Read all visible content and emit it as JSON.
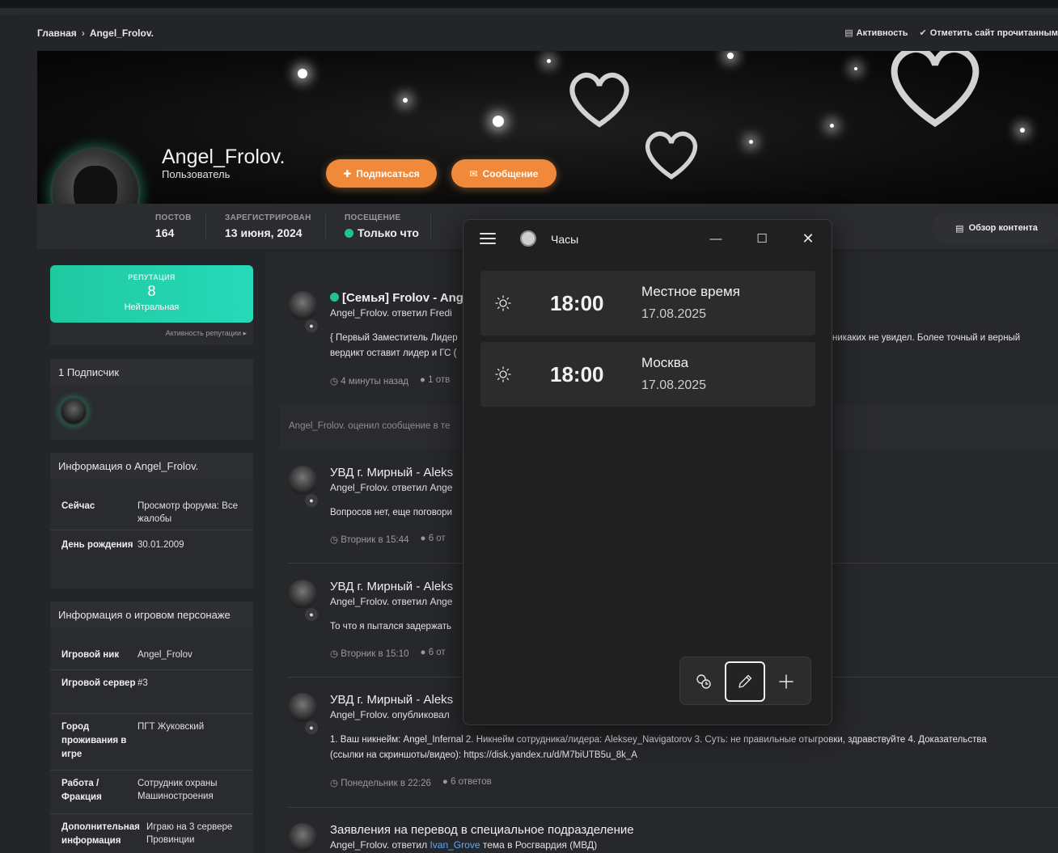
{
  "breadcrumb": {
    "home": "Главная",
    "sep": "›",
    "current": "Angel_Frolov."
  },
  "toplinks": {
    "activity": "Активность",
    "mark_read": "Отметить сайт прочитанным"
  },
  "profile": {
    "name": "Angel_Frolov.",
    "title": "Пользователь",
    "subscribe_label": "Подписаться",
    "message_label": "Сообщение"
  },
  "stats": {
    "posts_label": "Постов",
    "posts_value": "164",
    "registered_label": "Зарегистрирован",
    "registered_value": "13 июня, 2024",
    "visit_label": "Посещение",
    "visit_value": "Только что"
  },
  "overview_label": "Обзор контента",
  "reputation": {
    "title": "РЕПУТАЦИЯ",
    "value": "8",
    "status": "Нейтральная",
    "link": "Активность репутации ▸"
  },
  "followers": {
    "title": "1 Подписчик"
  },
  "about": {
    "title": "Информация о Angel_Frolov.",
    "rows": [
      {
        "k": "Сейчас",
        "v": "Просмотр форума: Все жалобы"
      },
      {
        "k": "День рождения",
        "v": "30.01.2009"
      }
    ]
  },
  "game": {
    "title": "Информация о игровом персонаже",
    "rows": [
      {
        "k": "Игровой ник",
        "v": "Angel_Frolov"
      },
      {
        "k": "Игровой сервер",
        "v": "#3"
      },
      {
        "k": "Город проживания в игре",
        "v": "ПГТ Жуковский"
      },
      {
        "k": "Работа / Фракция",
        "v": "Сотрудник охраны Машиностроения"
      },
      {
        "k": "Дополнительная информация",
        "v": "Играю на 3 сервере Провинции"
      }
    ]
  },
  "feed": [
    {
      "title": "[Семья] Frolov - Ang",
      "sub": "Angel_Frolov. ответил Fredi",
      "body": "{ Первый Заместитель Лидер",
      "body_right": "никаких не увидел. Более точный и верный",
      "body2": "вердикт оставит лидер и ГС (",
      "time": "4 минуты назад",
      "replies": "1 отв"
    },
    {
      "title": "УВД г. Мирный - Aleks",
      "sub": "Angel_Frolov. ответил Ange",
      "body": "Вопросов нет, еще поговори",
      "time": "Вторник в 15:44",
      "replies": "6 от"
    },
    {
      "title": "УВД г. Мирный - Aleks",
      "sub": "Angel_Frolov. ответил Ange",
      "body": "То что я пытался задержать",
      "time": "Вторник в 15:10",
      "replies": "6 от"
    },
    {
      "title": "УВД г. Мирный - Aleks",
      "sub": "Angel_Frolov. опубликовал",
      "body": "1. Ваш никнейм: Angel_Infernal 2. Никнейм сотрудника/лидера: Aleksey_Navigatorov 3. Суть: не правильные отыгровки, здравствуйте 4. Доказательства",
      "body2": "(ссылки на скриншоты/видео): https://disk.yandex.ru/d/M7biUTB5u_8k_A",
      "time": "Понедельник в 22:26",
      "replies": "6 ответов"
    },
    {
      "title": "Заявления на перевод в специальное подразделение",
      "sub_pre": "Angel_Frolov. ответил",
      "sub_link": "Ivan_Grove",
      "sub_post": "тема в Росгвардия (МВД)"
    }
  ],
  "activity_text": "Angel_Frolov. оценил сообщение в те",
  "clock": {
    "title": "Часы",
    "cards": [
      {
        "time": "18:00",
        "place": "Местное время",
        "date": "17.08.2025"
      },
      {
        "time": "18:00",
        "place": "Москва",
        "date": "17.08.2025"
      }
    ]
  }
}
